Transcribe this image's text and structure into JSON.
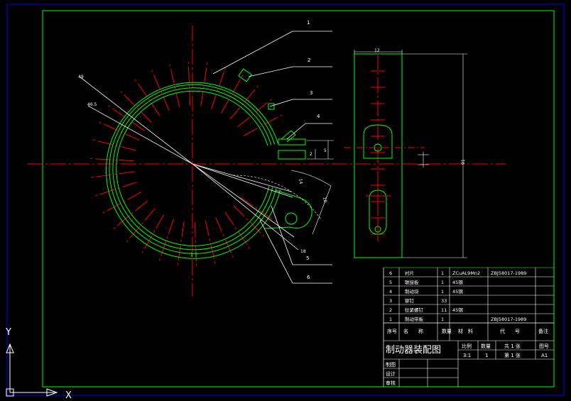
{
  "title_block": {
    "drawing_title": "制动器装配图",
    "header": {
      "seq": "序号",
      "name": "名　　称",
      "qty": "数量",
      "material": "材　料",
      "code": "代　　号",
      "remark": "备注"
    },
    "parts": [
      {
        "seq": "6",
        "name": "衬片",
        "qty": "1",
        "material": "ZCuAL9Mn2",
        "code": "ZBJ58017-1989"
      },
      {
        "seq": "5",
        "name": "联接板",
        "qty": "1",
        "material": "45钢",
        "code": ""
      },
      {
        "seq": "4",
        "name": "制动块",
        "qty": "1",
        "material": "45钢",
        "code": ""
      },
      {
        "seq": "3",
        "name": "铆钉",
        "qty": "33",
        "material": "",
        "code": ""
      },
      {
        "seq": "2",
        "name": "拉紧螺钉",
        "qty": "11",
        "material": "45钢",
        "code": ""
      },
      {
        "seq": "1",
        "name": "制动带板",
        "qty": "1",
        "material": "",
        "code": "ZBJ58017-1989"
      }
    ],
    "info": {
      "scale_label": "比例",
      "qty_label": "数量",
      "sheets_total": "共 1 张",
      "drawing_no_label": "图号",
      "scale": "3:1",
      "qty": "1",
      "sheet_no": "第 1 张",
      "drawing_no": "A1"
    },
    "sign_rows": [
      "制图",
      "设计",
      "审核"
    ]
  },
  "balloons": [
    "1",
    "2",
    "3",
    "4",
    "5",
    "6"
  ],
  "dimensions": {
    "radius_outer": "49",
    "radius_inner": "46.5",
    "small_a": "2",
    "small_b": "5",
    "width_top": "12",
    "height_right": "91",
    "angle_a": "14",
    "angle_b": "10",
    "dim_c": "18"
  },
  "ucs": {
    "x": "X",
    "y": "Y"
  },
  "colors": {
    "background": "#000000",
    "frame_outer": "#0000ff",
    "frame_inner": "#00ff00",
    "part_outline": "#00ff00",
    "center_line": "#ff0000",
    "annotation": "#ffffff",
    "hidden": "#808080"
  }
}
